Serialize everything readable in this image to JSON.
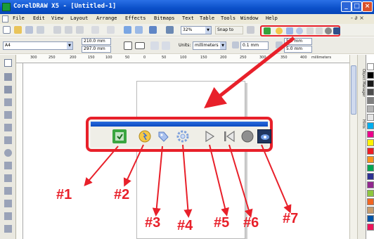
{
  "window": {
    "title": "CorelDRAW X5 - [Untitled-1]",
    "min_glyph": "_",
    "max_glyph": "□",
    "close_glyph": "×"
  },
  "menu": {
    "items": [
      "File",
      "Edit",
      "View",
      "Layout",
      "Arrange",
      "Effects",
      "Bitmaps",
      "Text",
      "Table",
      "Tools",
      "Window",
      "Help"
    ],
    "mdi_controls": "- ∂ ×"
  },
  "toolbar": {
    "zoom_value": "32%",
    "snap_label": "Snap to"
  },
  "property_bar": {
    "paper_size": "A4",
    "width_value": "210.0 mm",
    "height_value": "297.0 mm",
    "units_label": "Units:",
    "units_value": "millimeters",
    "nudge_value": "0.1 mm",
    "dup_x_value": "5.0 mm",
    "dup_y_value": "5.0 mm"
  },
  "ruler": {
    "labels": [
      "300",
      "250",
      "200",
      "150",
      "100",
      "50",
      "0",
      "50",
      "100",
      "150",
      "200",
      "250",
      "300",
      "350",
      "400"
    ],
    "unit_label": "millimeters"
  },
  "docker": {
    "tabs": [
      "Object Manager",
      "Hints"
    ]
  },
  "callouts": [
    "#1",
    "#2",
    "#3",
    "#4",
    "#5",
    "#6",
    "#7"
  ],
  "macro_buttons": [
    "record-start-icon",
    "play-icon",
    "stop-icon",
    "pause-icon",
    "run-icon",
    "rewind-icon",
    "record-icon"
  ],
  "colors": {
    "accent_red": "#e8202a",
    "title_blue": "#0a4fc8"
  }
}
